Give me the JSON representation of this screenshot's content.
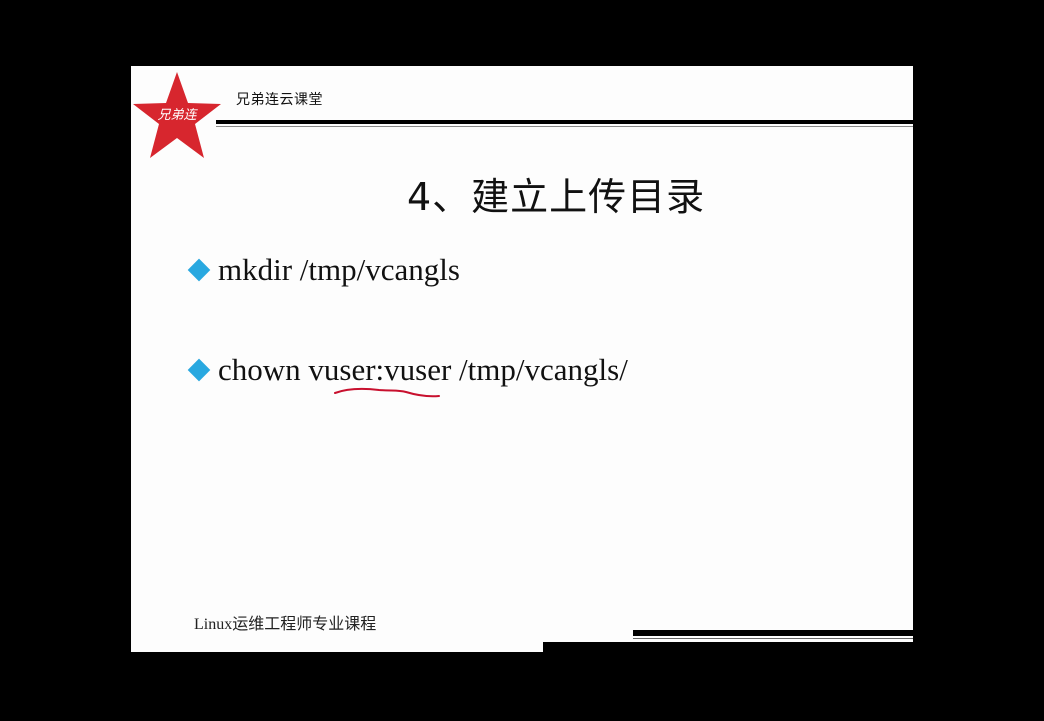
{
  "header": {
    "brand": "兄弟连云课堂",
    "logo_text": "兄弟连",
    "logo_color": "#d7262e"
  },
  "slide": {
    "title": "4、建立上传目录",
    "bullets": [
      {
        "text": "mkdir /tmp/vcangls"
      },
      {
        "text": "chown vuser:vuser /tmp/vcangls/"
      }
    ],
    "bullet_color": "#29a8e0",
    "annotation_color": "#c8102e"
  },
  "footer": {
    "course": "Linux运维工程师专业课程"
  }
}
